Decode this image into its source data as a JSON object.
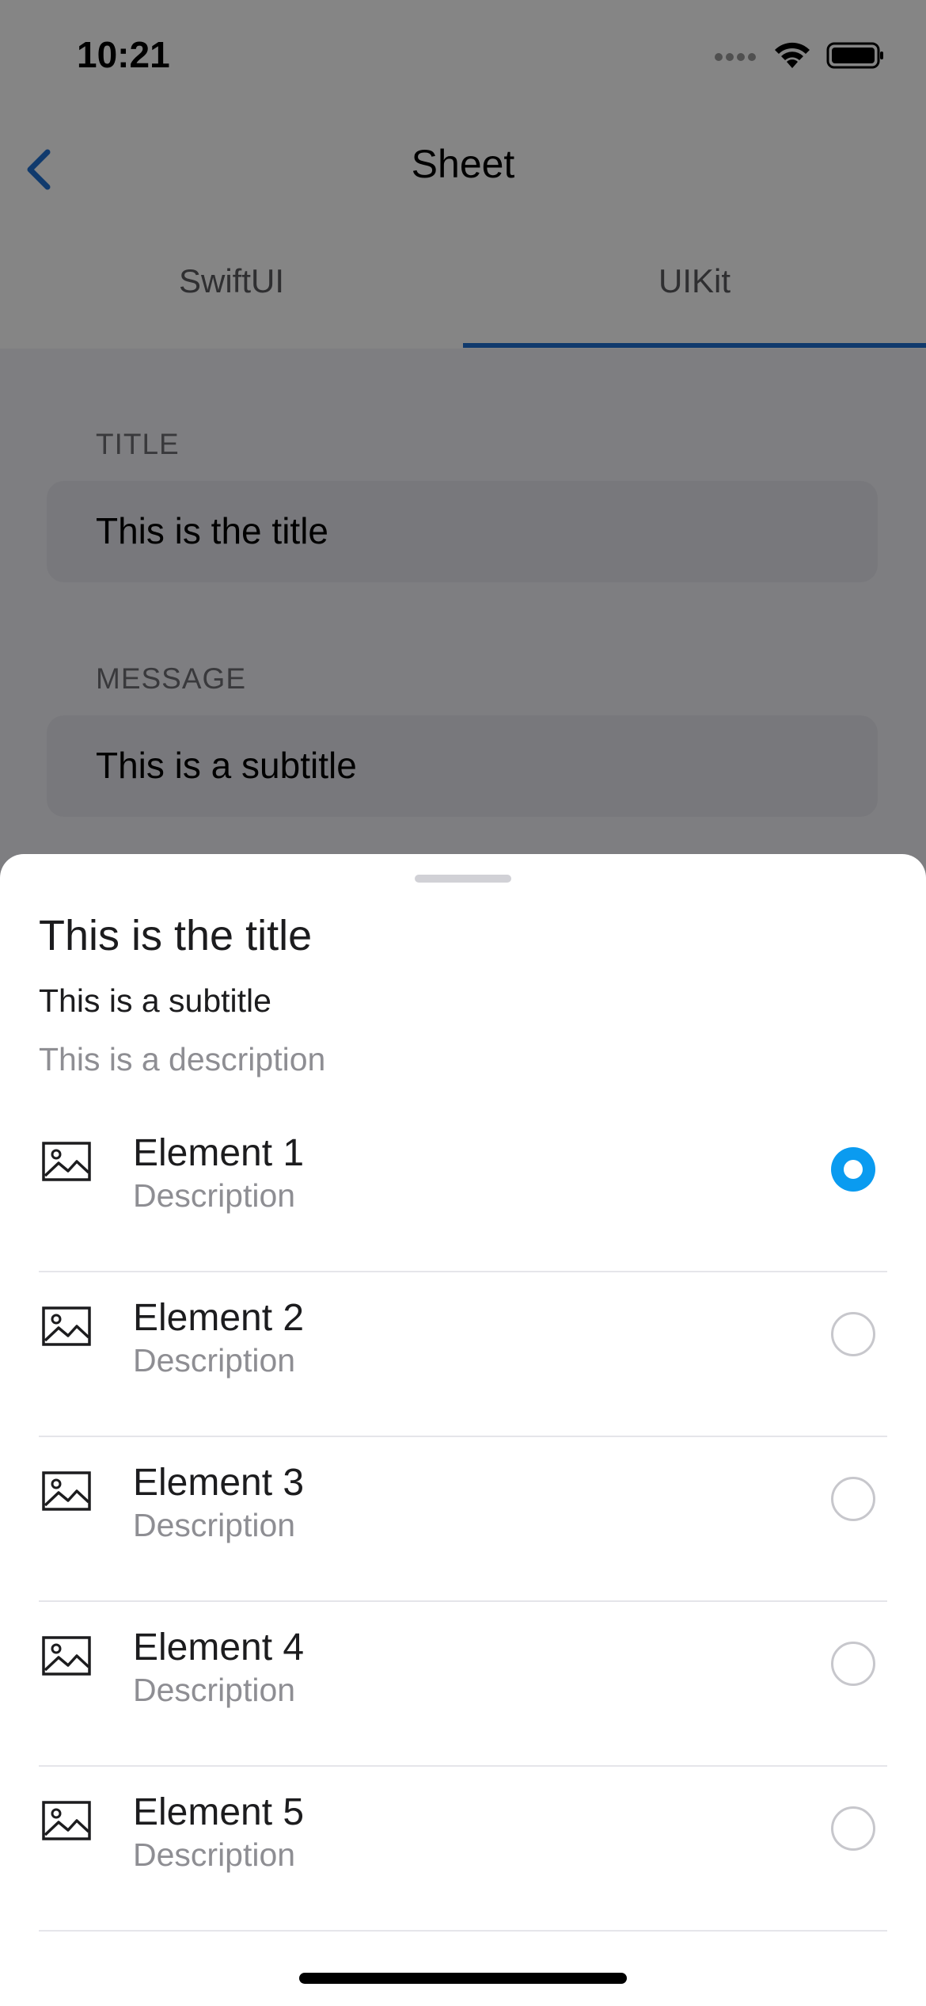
{
  "status_bar": {
    "time": "10:21"
  },
  "nav": {
    "title": "Sheet",
    "back_icon": "chevron-left-icon"
  },
  "segments": {
    "items": [
      "SwiftUI",
      "UIKit"
    ],
    "selected": "UIKit",
    "accent_color": "#1f6fd1"
  },
  "form": {
    "title_label": "TITLE",
    "title_value": "This is the title",
    "message_label": "MESSAGE",
    "message_value": "This is a subtitle"
  },
  "sheet": {
    "title": "This is the title",
    "subtitle": "This is a subtitle",
    "description": "This is a description",
    "items": [
      {
        "title": "Element 1",
        "description": "Description",
        "icon": "image-icon",
        "selected": true
      },
      {
        "title": "Element 2",
        "description": "Description",
        "icon": "image-icon",
        "selected": false
      },
      {
        "title": "Element 3",
        "description": "Description",
        "icon": "image-icon",
        "selected": false
      },
      {
        "title": "Element 4",
        "description": "Description",
        "icon": "image-icon",
        "selected": false
      },
      {
        "title": "Element 5",
        "description": "Description",
        "icon": "image-icon",
        "selected": false
      }
    ],
    "selection_color": "#0a9bf0"
  }
}
